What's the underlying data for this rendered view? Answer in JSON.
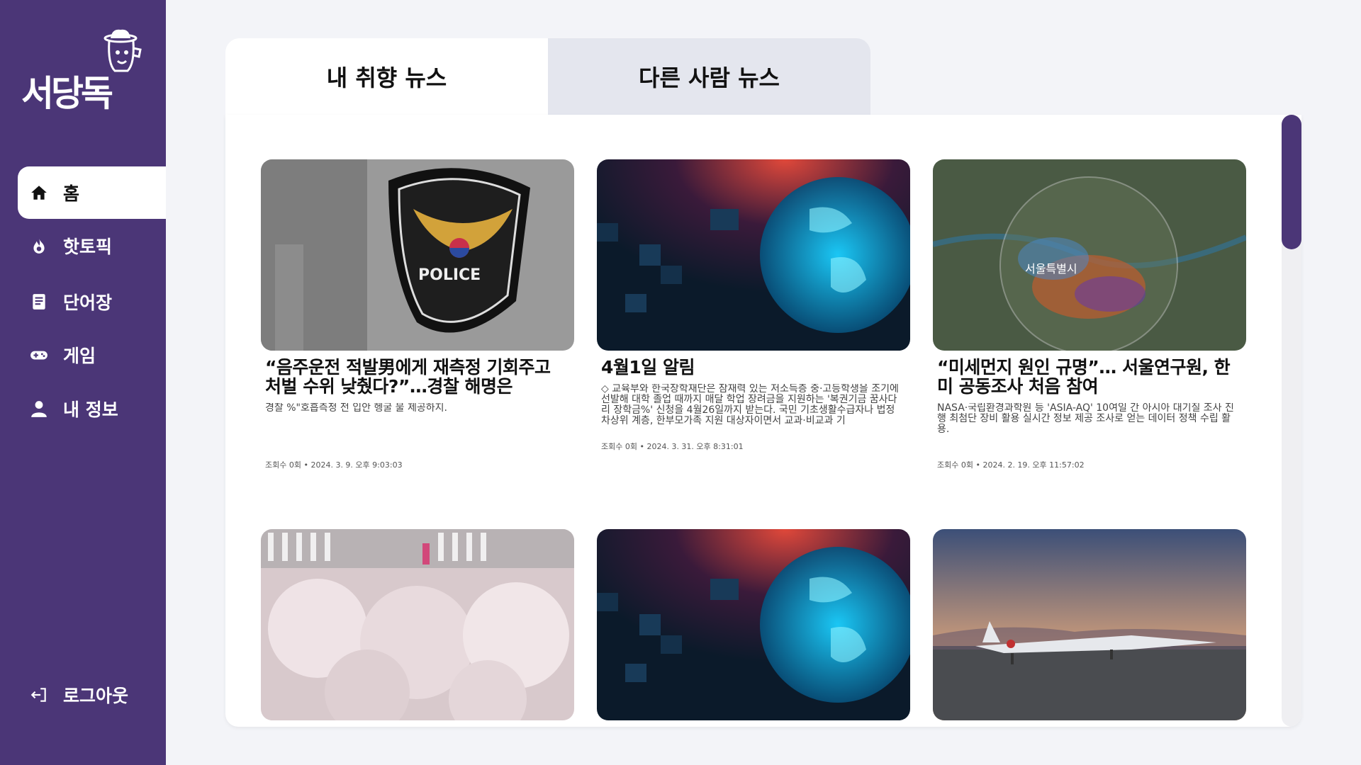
{
  "brand": {
    "logo_text": "서당독"
  },
  "sidebar": {
    "items": [
      {
        "label": "홈",
        "icon": "home-icon",
        "active": true
      },
      {
        "label": "핫토픽",
        "icon": "fire-icon"
      },
      {
        "label": "단어장",
        "icon": "notebook-icon"
      },
      {
        "label": "게임",
        "icon": "gamepad-icon"
      },
      {
        "label": "내 정보",
        "icon": "user-icon"
      }
    ],
    "logout_label": "로그아웃"
  },
  "tabs": [
    {
      "label": "내 취향 뉴스",
      "active": true
    },
    {
      "label": "다른 사람 뉴스",
      "active": false
    }
  ],
  "articles": [
    {
      "title": "“음주운전 적발男에게 재측정 기회주고 처벌 수위 낮췄다?”…경찰 해명은",
      "summary": "경찰 %\"호흡측정 전 입안 헹굴 물 제공하지.",
      "meta": "조회수 0회 •  2024. 3. 9. 오후 9:03:03",
      "image": "police-badge"
    },
    {
      "title": "4월1일 알림",
      "summary": "◇ 교육부와 한국장학재단은 잠재력 있는 저소득층 중·고등학생을 조기에 선발해 대학 졸업 때까지 매달 학업 장려금을 지원하는 '복권기금 꿈사다리 장학금%' 신청을 4월26일까지 받는다. 국민 기초생활수급자나 법정 차상위 계층, 한부모가족 지원 대상자이면서 교과·비교과 기",
      "meta": "조회수 0회 •  2024. 3. 31. 오후 8:31:01",
      "image": "globe"
    },
    {
      "title": "“미세먼지 원인 규명”… 서울연구원, 한미 공동조사 처음 참여",
      "summary": "NASA·국립환경과학원 등 'ASIA-AQ' 10여일 간 아시아 대기질 조사 진행 최첨단 장비 활용 실시간 정보 제공 조사로 얻는 데이터 정책 수립 활용.",
      "meta": "조회수 0회 •  2024. 2. 19. 오후 11:57:02",
      "image": "seoul-map"
    },
    {
      "image": "cherry-blossom"
    },
    {
      "image": "globe"
    },
    {
      "image": "jet-aircraft"
    }
  ],
  "colors": {
    "sidebar": "#4b3677",
    "accent": "#4b3677",
    "background": "#f3f4f8"
  },
  "map_label": "서울특별시"
}
